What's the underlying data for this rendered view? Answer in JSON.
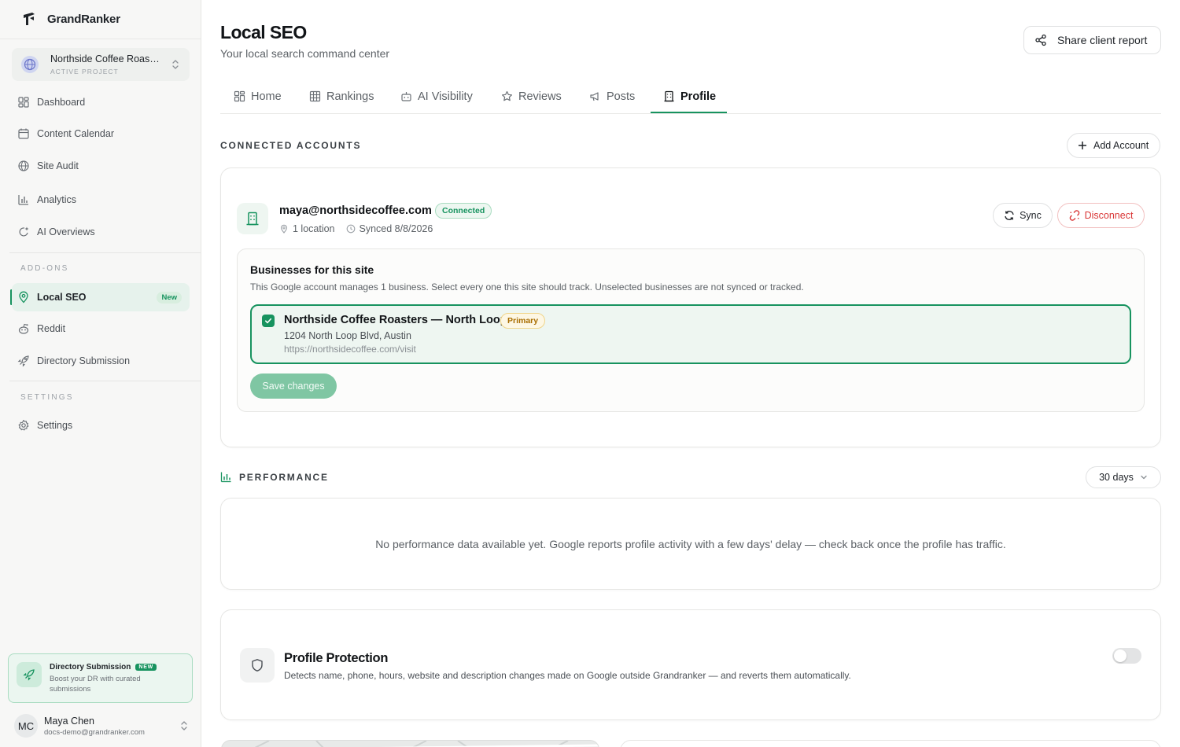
{
  "brand": {
    "name": "GrandRanker"
  },
  "project": {
    "name": "Northside Coffee Roasters",
    "label": "ACTIVE PROJECT"
  },
  "sidebar": {
    "main_items": [
      {
        "label": "Dashboard",
        "icon": "dashboard-icon"
      },
      {
        "label": "Content Calendar",
        "icon": "calendar-icon"
      },
      {
        "label": "Site Audit",
        "icon": "globe-icon"
      },
      {
        "label": "Analytics",
        "icon": "bar-chart-icon"
      },
      {
        "label": "AI Overviews",
        "icon": "ai-sparkle-icon"
      }
    ],
    "addons_label": "ADD-ONS",
    "addons": [
      {
        "label": "Local SEO",
        "icon": "map-pin-icon",
        "badge": "New",
        "active": true
      },
      {
        "label": "Reddit",
        "icon": "reddit-icon"
      },
      {
        "label": "Directory Submission",
        "icon": "rocket-icon"
      }
    ],
    "settings_label": "SETTINGS",
    "settings": [
      {
        "label": "Settings",
        "icon": "gear-icon"
      }
    ],
    "promo": {
      "title": "Directory Submission",
      "badge": "NEW",
      "description": "Boost your DR with curated submissions"
    },
    "user": {
      "initials": "MC",
      "name": "Maya Chen",
      "email": "docs-demo@grandranker.com"
    }
  },
  "header": {
    "title": "Local SEO",
    "subtitle": "Your local search command center",
    "share_label": "Share client report"
  },
  "tabs": [
    {
      "label": "Home",
      "icon": "grid-icon"
    },
    {
      "label": "Rankings",
      "icon": "table-icon"
    },
    {
      "label": "AI Visibility",
      "icon": "robot-icon"
    },
    {
      "label": "Reviews",
      "icon": "star-icon"
    },
    {
      "label": "Posts",
      "icon": "megaphone-icon"
    },
    {
      "label": "Profile",
      "icon": "building-icon",
      "active": true
    }
  ],
  "connected_accounts": {
    "heading": "CONNECTED ACCOUNTS",
    "add_label": "Add Account",
    "account": {
      "email": "maya@northsidecoffee.com",
      "status": "Connected",
      "locations": "1 location",
      "synced": "Synced 8/8/2026",
      "sync_label": "Sync",
      "disconnect_label": "Disconnect"
    },
    "businesses": {
      "title": "Businesses for this site",
      "description": "This Google account manages 1 business. Select every one this site should track. Unselected businesses are not synced or tracked.",
      "items": [
        {
          "name": "Northside Coffee Roasters — North Loop",
          "badge": "Primary",
          "address": "1204 North Loop Blvd, Austin",
          "url": "https://northsidecoffee.com/visit",
          "checked": true
        }
      ],
      "save_label": "Save changes"
    }
  },
  "performance": {
    "heading": "PERFORMANCE",
    "range": "30 days",
    "empty_message": "No performance data available yet. Google reports profile activity with a few days' delay — check back once the profile has traffic."
  },
  "protection": {
    "title": "Profile Protection",
    "description": "Detects name, phone, hours, website and description changes made on Google outside Grandranker — and reverts them automatically.",
    "enabled": false
  },
  "colors": {
    "accent": "#17935f",
    "danger": "#d93636",
    "warning": "#a86d00"
  }
}
